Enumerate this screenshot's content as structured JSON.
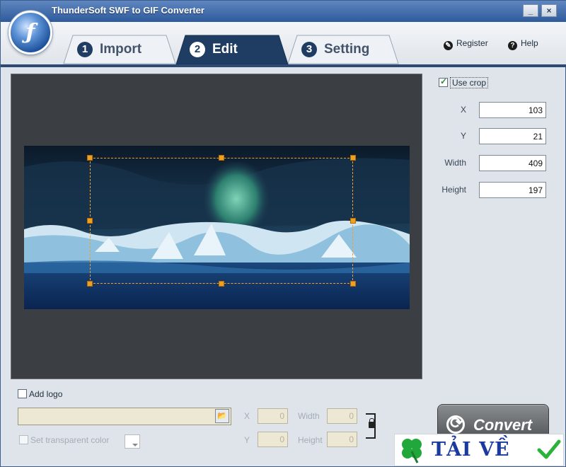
{
  "window": {
    "title": "ThunderSoft SWF to GIF Converter",
    "minimize_label": "_",
    "close_label": "×"
  },
  "tabs": [
    {
      "number": "1",
      "label": "Import"
    },
    {
      "number": "2",
      "label": "Edit"
    },
    {
      "number": "3",
      "label": "Setting"
    }
  ],
  "header": {
    "register_label": "Register",
    "help_label": "Help"
  },
  "crop": {
    "use_crop_label": "Use crop",
    "x_label": "X",
    "x_value": "103",
    "y_label": "Y",
    "y_value": "21",
    "width_label": "Width",
    "width_value": "409",
    "height_label": "Height",
    "height_value": "197"
  },
  "logo": {
    "add_logo_label": "Add logo",
    "x_label": "X",
    "x_value": "0",
    "y_label": "Y",
    "y_value": "0",
    "width_label": "Width",
    "width_value": "0",
    "height_label": "Height",
    "height_value": "0",
    "transparent_label": "Set transparent color"
  },
  "convert": {
    "label": "Convert"
  },
  "watermark": {
    "text": "TẢI VỀ"
  },
  "colors": {
    "active_tab": "#1f3d62",
    "crop_handle": "#f0a020",
    "watermark_text": "#1a3aa0",
    "watermark_clover": "#22a83a"
  }
}
